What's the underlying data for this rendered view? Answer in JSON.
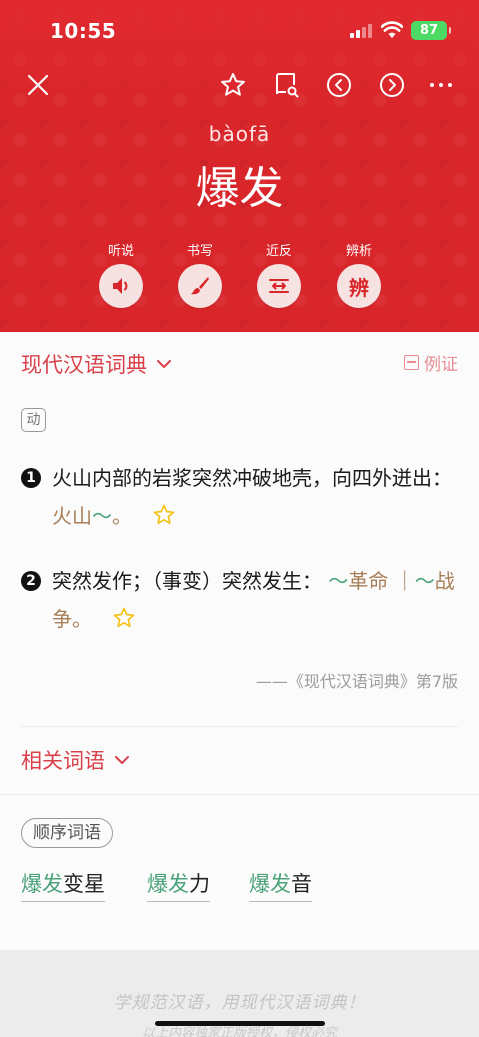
{
  "status": {
    "time": "10:55",
    "battery": "87"
  },
  "toolbar": {
    "close": "close-icon",
    "favorite": "star-icon",
    "lookup": "book-search-icon",
    "prev": "chevron-left-icon",
    "next": "chevron-right-icon",
    "more": "more-icon"
  },
  "entry": {
    "pinyin": "bàofā",
    "word": "爆发"
  },
  "tools": [
    {
      "label": "听说",
      "icon": "speaker-icon"
    },
    {
      "label": "书写",
      "icon": "brush-icon"
    },
    {
      "label": "近反",
      "icon": "swap-icon"
    },
    {
      "label": "辨析",
      "glyph": "辨"
    }
  ],
  "dictionary": {
    "title": "现代汉语词典",
    "example_toggle": "例证",
    "pos": "动",
    "senses": [
      {
        "num": "1",
        "text": "火山内部的岩浆突然冲破地壳，向四外迸出：",
        "example_word": "火山",
        "tilde": "〜",
        "end": "。"
      },
      {
        "num": "2",
        "text": "突然发作；（事变）突然发生：",
        "tilde1": "〜",
        "example1": "革命",
        "sep": "｜",
        "tilde2": "〜",
        "example2": "战争",
        "end": "。"
      }
    ],
    "source": "——《现代汉语词典》第7版"
  },
  "related": {
    "title": "相关词语",
    "chip": "顺序词语",
    "words": [
      {
        "hl": "爆发",
        "rest": "变星"
      },
      {
        "hl": "爆发",
        "rest": "力"
      },
      {
        "hl": "爆发",
        "rest": "音"
      }
    ]
  },
  "footer": {
    "slogan": "学规范汉语，用现代汉语词典！",
    "slogan2": "以上内容独家正版授权，侵权必究"
  },
  "colors": {
    "brand_red": "#d9262b",
    "link_green": "#4aa27a",
    "example_brown": "#a87e57"
  }
}
